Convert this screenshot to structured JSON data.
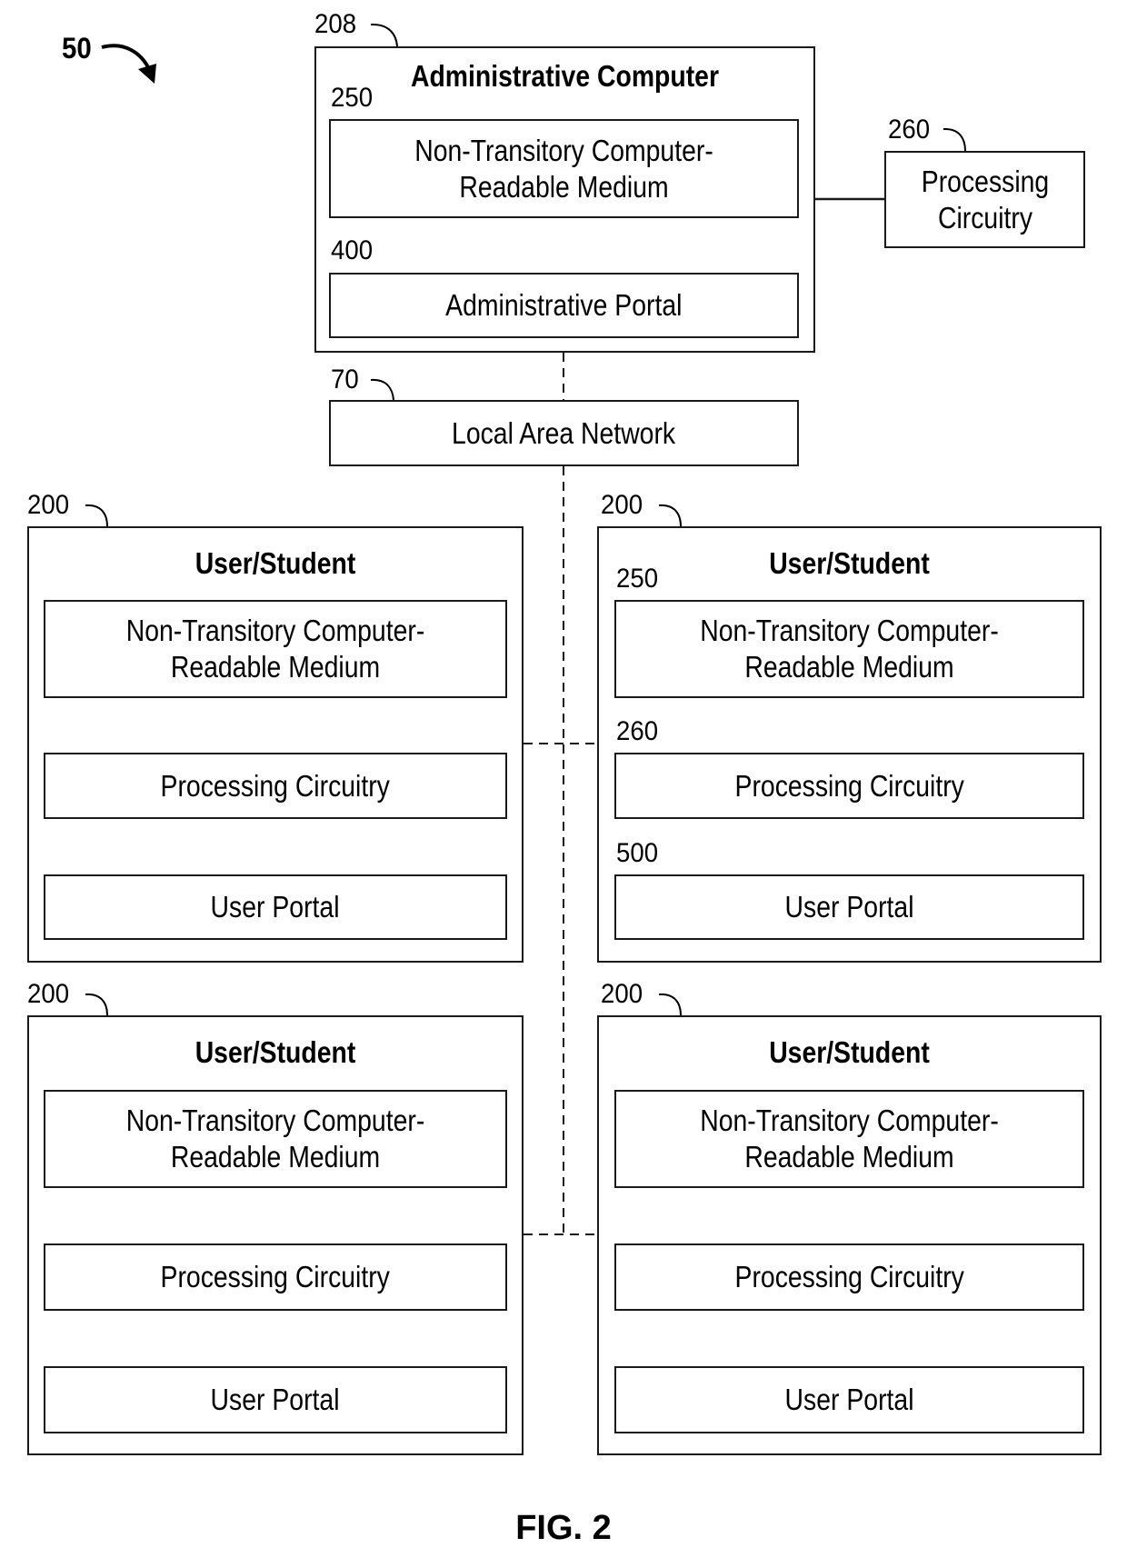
{
  "figure": {
    "ref": "50",
    "caption": "FIG. 2"
  },
  "admin_computer": {
    "ref": "208",
    "title": "Administrative Computer",
    "medium": {
      "ref": "250",
      "label": "Non-Transitory Computer-Readable Medium"
    },
    "portal": {
      "ref": "400",
      "label": "Administrative Portal"
    }
  },
  "admin_processing": {
    "ref": "260",
    "label": "Processing Circuitry"
  },
  "network": {
    "ref": "70",
    "label": "Local Area Network"
  },
  "users": [
    {
      "ref": "200",
      "title": "User/Student",
      "medium": {
        "ref": "",
        "label": "Non-Transitory Computer-Readable Medium"
      },
      "processing": {
        "ref": "",
        "label": "Processing Circuitry"
      },
      "portal": {
        "ref": "",
        "label": "User Portal"
      }
    },
    {
      "ref": "200",
      "title": "User/Student",
      "medium": {
        "ref": "250",
        "label": "Non-Transitory Computer-Readable Medium"
      },
      "processing": {
        "ref": "260",
        "label": "Processing Circuitry"
      },
      "portal": {
        "ref": "500",
        "label": "User Portal"
      }
    },
    {
      "ref": "200",
      "title": "User/Student",
      "medium": {
        "ref": "",
        "label": "Non-Transitory Computer-Readable Medium"
      },
      "processing": {
        "ref": "",
        "label": "Processing Circuitry"
      },
      "portal": {
        "ref": "",
        "label": "User Portal"
      }
    },
    {
      "ref": "200",
      "title": "User/Student",
      "medium": {
        "ref": "",
        "label": "Non-Transitory Computer-Readable Medium"
      },
      "processing": {
        "ref": "",
        "label": "Processing Circuitry"
      },
      "portal": {
        "ref": "",
        "label": "User Portal"
      }
    }
  ]
}
